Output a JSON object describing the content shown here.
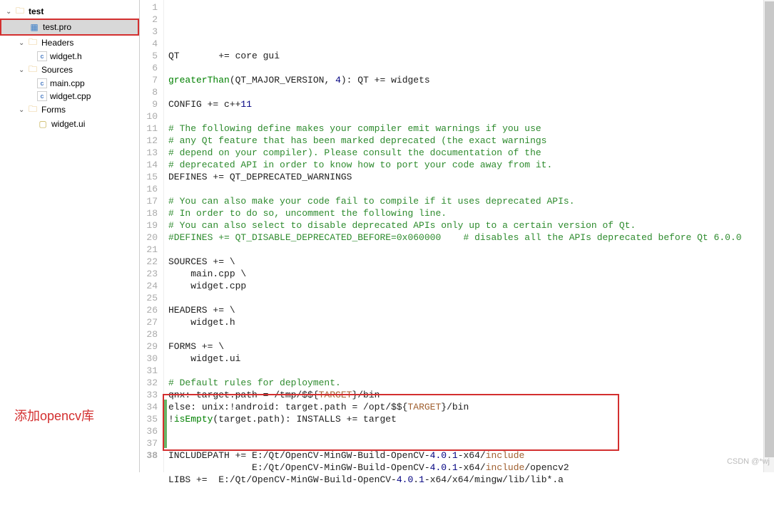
{
  "tree": {
    "root": {
      "label": "test",
      "expanded": true
    },
    "pro": {
      "label": "test.pro"
    },
    "headers": {
      "label": "Headers",
      "expanded": true,
      "items": [
        "widget.h"
      ]
    },
    "sources": {
      "label": "Sources",
      "expanded": true,
      "items": [
        "main.cpp",
        "widget.cpp"
      ]
    },
    "forms": {
      "label": "Forms",
      "expanded": true,
      "items": [
        "widget.ui"
      ]
    }
  },
  "red_annotation": "添加opencv库",
  "watermark": "CSDN @*wj",
  "code_lines": [
    {
      "n": 1,
      "segs": [
        [
          "QT       += core gui",
          "kw-black"
        ]
      ]
    },
    {
      "n": 2,
      "segs": [
        [
          "",
          "kw-black"
        ]
      ]
    },
    {
      "n": 3,
      "segs": [
        [
          "greaterThan",
          "kw-green"
        ],
        [
          "(QT_MAJOR_VERSION, ",
          "kw-black"
        ],
        [
          "4",
          "kw-num"
        ],
        [
          "): QT += widgets",
          "kw-black"
        ]
      ]
    },
    {
      "n": 4,
      "segs": [
        [
          "",
          "kw-black"
        ]
      ]
    },
    {
      "n": 5,
      "segs": [
        [
          "CONFIG += c++",
          "kw-black"
        ],
        [
          "11",
          "kw-num"
        ]
      ]
    },
    {
      "n": 6,
      "segs": [
        [
          "",
          "kw-black"
        ]
      ]
    },
    {
      "n": 7,
      "segs": [
        [
          "# The following define makes your compiler emit warnings if you use",
          "kw-darkgreen"
        ]
      ]
    },
    {
      "n": 8,
      "segs": [
        [
          "# any Qt feature that has been marked deprecated (the exact warnings",
          "kw-darkgreen"
        ]
      ]
    },
    {
      "n": 9,
      "segs": [
        [
          "# depend on your compiler). Please consult the documentation of the",
          "kw-darkgreen"
        ]
      ]
    },
    {
      "n": 10,
      "segs": [
        [
          "# deprecated API in order to know how to port your code away from it.",
          "kw-darkgreen"
        ]
      ]
    },
    {
      "n": 11,
      "segs": [
        [
          "DEFINES += QT_DEPRECATED_WARNINGS",
          "kw-black"
        ]
      ]
    },
    {
      "n": 12,
      "segs": [
        [
          "",
          "kw-black"
        ]
      ]
    },
    {
      "n": 13,
      "segs": [
        [
          "# You can also make your code fail to compile if it uses deprecated APIs.",
          "kw-darkgreen"
        ]
      ]
    },
    {
      "n": 14,
      "segs": [
        [
          "# In order to do so, uncomment the following line.",
          "kw-darkgreen"
        ]
      ]
    },
    {
      "n": 15,
      "segs": [
        [
          "# You can also select to disable deprecated APIs only up to a certain version of Qt.",
          "kw-darkgreen"
        ]
      ]
    },
    {
      "n": 16,
      "segs": [
        [
          "#DEFINES += QT_DISABLE_DEPRECATED_BEFORE=0x060000    # disables all the APIs deprecated before Qt 6.0.0",
          "kw-darkgreen"
        ]
      ]
    },
    {
      "n": 17,
      "segs": [
        [
          "",
          "kw-black"
        ]
      ]
    },
    {
      "n": 18,
      "segs": [
        [
          "SOURCES += \\",
          "kw-black"
        ]
      ]
    },
    {
      "n": 19,
      "segs": [
        [
          "    main.cpp \\",
          "kw-black"
        ]
      ]
    },
    {
      "n": 20,
      "segs": [
        [
          "    widget.cpp",
          "kw-black"
        ]
      ]
    },
    {
      "n": 21,
      "segs": [
        [
          "",
          "kw-black"
        ]
      ]
    },
    {
      "n": 22,
      "segs": [
        [
          "HEADERS += \\",
          "kw-black"
        ]
      ]
    },
    {
      "n": 23,
      "segs": [
        [
          "    widget.h",
          "kw-black"
        ]
      ]
    },
    {
      "n": 24,
      "segs": [
        [
          "",
          "kw-black"
        ]
      ]
    },
    {
      "n": 25,
      "segs": [
        [
          "FORMS += \\",
          "kw-black"
        ]
      ]
    },
    {
      "n": 26,
      "segs": [
        [
          "    widget.ui",
          "kw-black"
        ]
      ]
    },
    {
      "n": 27,
      "segs": [
        [
          "",
          "kw-black"
        ]
      ]
    },
    {
      "n": 28,
      "segs": [
        [
          "# Default rules for deployment.",
          "kw-darkgreen"
        ]
      ]
    },
    {
      "n": 29,
      "segs": [
        [
          "qnx: target.path = /tmp/$${",
          "kw-black"
        ],
        [
          "TARGET",
          "kw-brown"
        ],
        [
          "}/bin",
          "kw-black"
        ]
      ]
    },
    {
      "n": 30,
      "segs": [
        [
          "else",
          "kw-black"
        ],
        [
          ": unix:!android: target.path = /opt/$${",
          "kw-black"
        ],
        [
          "TARGET",
          "kw-brown"
        ],
        [
          "}/bin",
          "kw-black"
        ]
      ]
    },
    {
      "n": 31,
      "segs": [
        [
          "!",
          "kw-black"
        ],
        [
          "isEmpty",
          "kw-green"
        ],
        [
          "(target.path): INSTALLS += target",
          "kw-black"
        ]
      ]
    },
    {
      "n": 32,
      "segs": [
        [
          "",
          "kw-black"
        ]
      ]
    },
    {
      "n": 33,
      "segs": [
        [
          "",
          "kw-black"
        ]
      ]
    },
    {
      "n": 34,
      "segs": [
        [
          "INCLUDEPATH += E:/Qt/OpenCV-MinGW-Build-OpenCV-",
          "kw-black"
        ],
        [
          "4.0",
          "kw-num"
        ],
        [
          ".",
          "kw-black"
        ],
        [
          "1",
          "kw-num"
        ],
        [
          "-x64/",
          "kw-black"
        ],
        [
          "include",
          "kw-brown"
        ]
      ]
    },
    {
      "n": 35,
      "segs": [
        [
          "               E:/Qt/OpenCV-MinGW-Build-OpenCV-",
          "kw-black"
        ],
        [
          "4.0",
          "kw-num"
        ],
        [
          ".",
          "kw-black"
        ],
        [
          "1",
          "kw-num"
        ],
        [
          "-x64/",
          "kw-black"
        ],
        [
          "include",
          "kw-brown"
        ],
        [
          "/opencv2",
          "kw-black"
        ]
      ]
    },
    {
      "n": 36,
      "segs": [
        [
          "LIBS +=  E:/Qt/OpenCV-MinGW-Build-OpenCV-",
          "kw-black"
        ],
        [
          "4.0",
          "kw-num"
        ],
        [
          ".",
          "kw-black"
        ],
        [
          "1",
          "kw-num"
        ],
        [
          "-x64/x64/mingw/lib/lib*.a",
          "kw-black"
        ]
      ]
    },
    {
      "n": 37,
      "segs": [
        [
          "",
          "kw-black"
        ]
      ]
    },
    {
      "n": 38,
      "bold": true,
      "segs": [
        [
          "",
          "kw-black"
        ]
      ]
    }
  ]
}
